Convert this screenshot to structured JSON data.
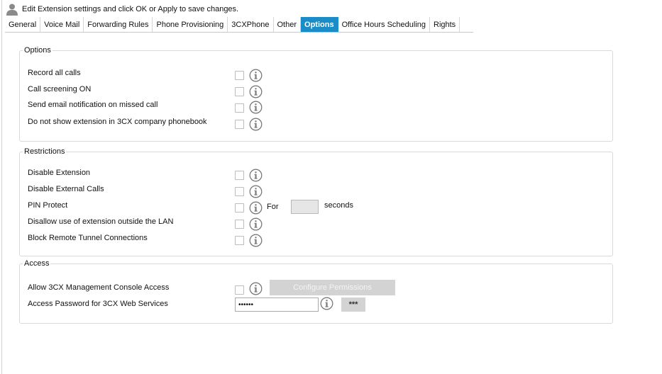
{
  "header": {
    "text": "Edit Extension settings and click OK or Apply to save changes."
  },
  "tabs": [
    {
      "label": "General",
      "active": false
    },
    {
      "label": "Voice Mail",
      "active": false
    },
    {
      "label": "Forwarding Rules",
      "active": false
    },
    {
      "label": "Phone Provisioning",
      "active": false
    },
    {
      "label": "3CXPhone",
      "active": false
    },
    {
      "label": "Other",
      "active": false
    },
    {
      "label": "Options",
      "active": true
    },
    {
      "label": "Office Hours Scheduling",
      "active": false
    },
    {
      "label": "Rights",
      "active": false
    }
  ],
  "options": {
    "legend": "Options",
    "rows": [
      {
        "label": "Record all calls",
        "checked": false
      },
      {
        "label": "Call screening ON",
        "checked": false
      },
      {
        "label": "Send email notification on missed call",
        "checked": false
      },
      {
        "label": "Do not show extension in 3CX company phonebook",
        "checked": false
      }
    ]
  },
  "restrictions": {
    "legend": "Restrictions",
    "rows": [
      {
        "label": "Disable Extension",
        "checked": false
      },
      {
        "label": "Disable External Calls",
        "checked": false
      },
      {
        "label": "PIN Protect",
        "checked": false
      },
      {
        "label": "Disallow use of extension outside the LAN",
        "checked": false
      },
      {
        "label": "Block Remote Tunnel Connections",
        "checked": false
      }
    ],
    "pin_for_label": "For",
    "pin_seconds_value": "",
    "pin_seconds_label": "seconds"
  },
  "access": {
    "legend": "Access",
    "console_label": "Allow 3CX Management Console Access",
    "console_checked": false,
    "configure_button": "Configure Permissions",
    "password_label": "Access Password for 3CX Web Services",
    "password_value": "••••••",
    "mask_button": "***"
  },
  "colors": {
    "active_tab": "#1a8cc7",
    "disabled_button": "#d3d3d3"
  },
  "icons": {
    "header": "user-icon",
    "help": "info-icon"
  }
}
